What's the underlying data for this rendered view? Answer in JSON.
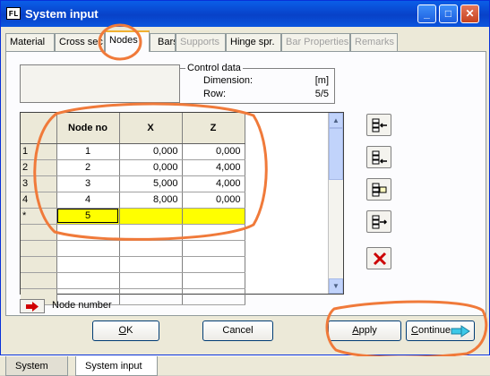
{
  "window": {
    "icon_text": "FL",
    "title": "System input",
    "buttons": {
      "minimize": "_",
      "maximize": "□",
      "close": "✕"
    }
  },
  "tabs": [
    {
      "label": "Material",
      "state": "normal"
    },
    {
      "label": "Cross sec",
      "state": "normal"
    },
    {
      "label": "Nodes",
      "state": "active"
    },
    {
      "label": "Bars",
      "state": "normal"
    },
    {
      "label": "Supports",
      "state": "disabled"
    },
    {
      "label": "Hinge spr.",
      "state": "normal"
    },
    {
      "label": "Bar Properties",
      "state": "disabled"
    },
    {
      "label": "Remarks",
      "state": "disabled"
    }
  ],
  "control_data": {
    "legend": "Control data",
    "dimension_label": "Dimension:",
    "dimension_value": "[m]",
    "row_label": "Row:",
    "row_value": "5/5"
  },
  "grid": {
    "columns": [
      "Node no",
      "X",
      "Z"
    ],
    "rows": [
      {
        "row_header": "1",
        "node": "1",
        "x": "0,000",
        "z": "0,000"
      },
      {
        "row_header": "2",
        "node": "2",
        "x": "0,000",
        "z": "4,000"
      },
      {
        "row_header": "3",
        "node": "3",
        "x": "5,000",
        "z": "4,000"
      },
      {
        "row_header": "4",
        "node": "4",
        "x": "8,000",
        "z": "0,000"
      }
    ],
    "new_row": {
      "row_header": "*",
      "node": "5",
      "x": "",
      "z": ""
    },
    "empty_row_count": 5,
    "new_row_color": "#ffff00"
  },
  "side_buttons": [
    {
      "icon": "insert-row-before-icon"
    },
    {
      "icon": "insert-row-after-icon"
    },
    {
      "icon": "copy-row-icon"
    },
    {
      "icon": "append-row-icon"
    },
    {
      "icon": "delete-row-icon",
      "color": "#cc0000"
    }
  ],
  "legend": {
    "icon": "red-arrow-icon",
    "text": "Node number"
  },
  "buttons": {
    "ok": {
      "pre": "",
      "underline": "O",
      "post": "K"
    },
    "cancel": {
      "label": "Cancel"
    },
    "apply": {
      "pre": "",
      "underline": "A",
      "post": "pply"
    },
    "continue": {
      "pre": "",
      "underline": "C",
      "post": "ontinue",
      "icon": "cyan-arrow-icon"
    }
  },
  "taskbar": [
    {
      "label": "System"
    },
    {
      "label": "System input",
      "active": true
    }
  ],
  "annotation_color": "#f07a3a"
}
